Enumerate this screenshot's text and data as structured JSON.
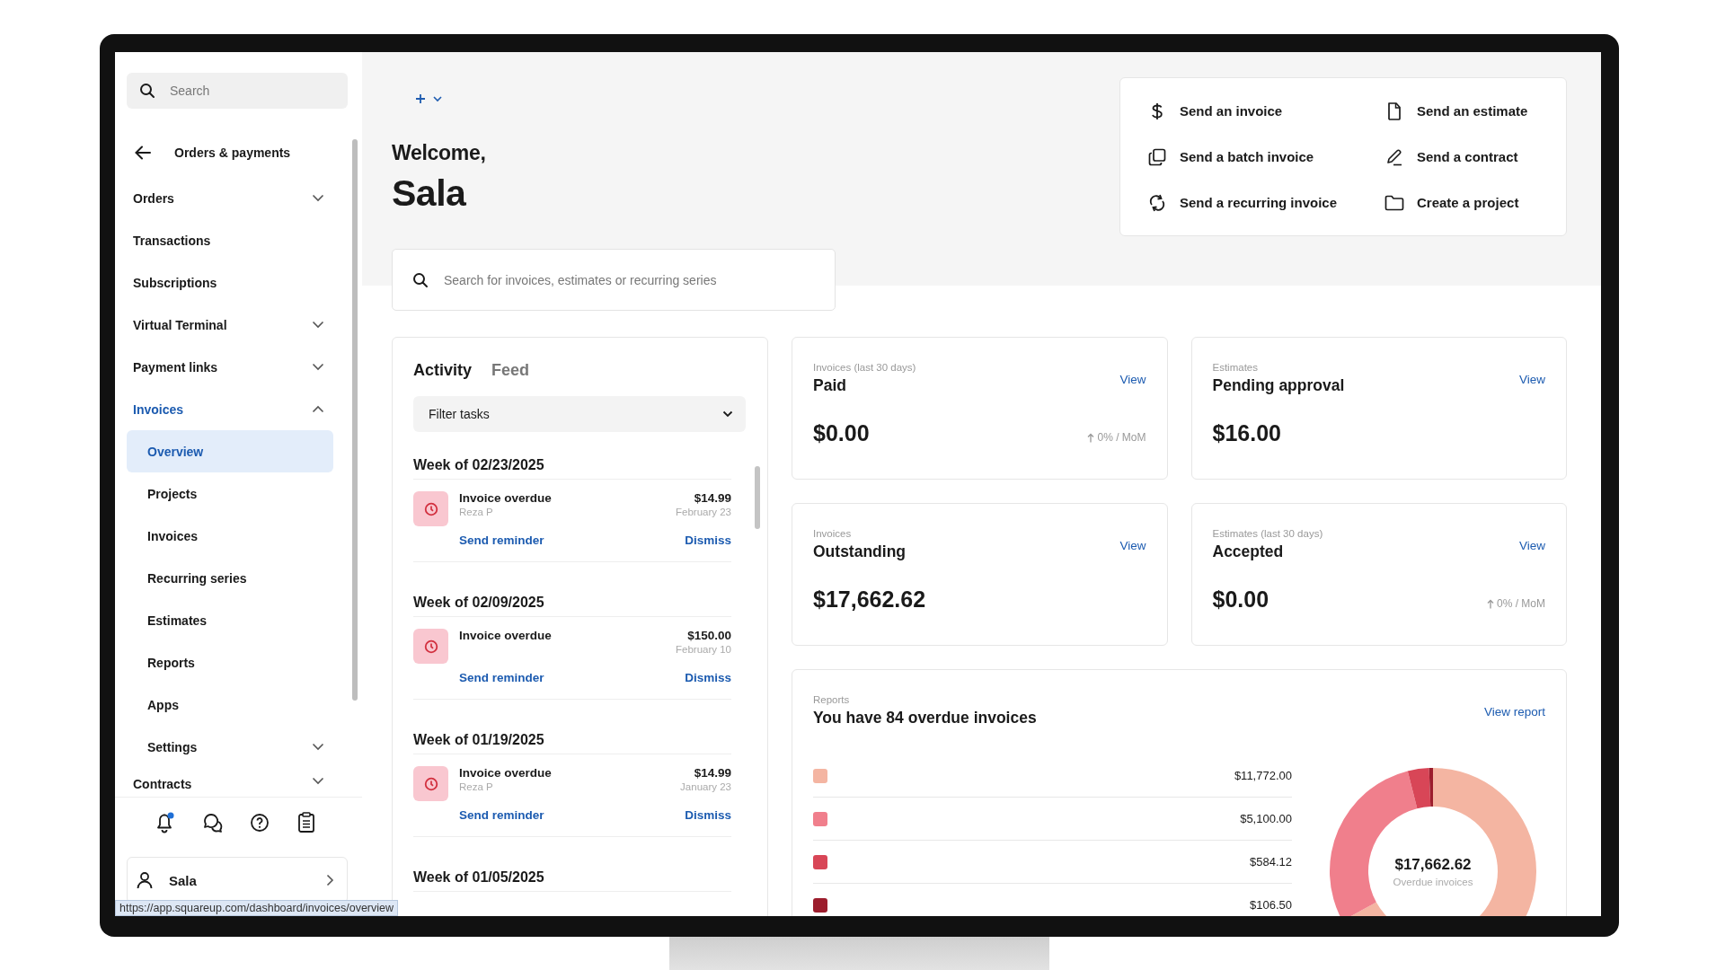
{
  "sidebar": {
    "search": {
      "placeholder": "Search"
    },
    "back_title": "Orders & payments",
    "items": [
      {
        "label": "Orders",
        "kind": "group",
        "expanded": false,
        "selected": false
      },
      {
        "label": "Transactions",
        "kind": "link",
        "selected": false
      },
      {
        "label": "Subscriptions",
        "kind": "link",
        "selected": false
      },
      {
        "label": "Virtual Terminal",
        "kind": "group",
        "expanded": false,
        "selected": false
      },
      {
        "label": "Payment links",
        "kind": "group",
        "expanded": false,
        "selected": false
      },
      {
        "label": "Invoices",
        "kind": "group",
        "expanded": true,
        "selected": false,
        "children": [
          {
            "label": "Overview",
            "kind": "link",
            "selected": true
          },
          {
            "label": "Projects",
            "kind": "link",
            "selected": false
          },
          {
            "label": "Invoices",
            "kind": "link",
            "selected": false
          },
          {
            "label": "Recurring series",
            "kind": "link",
            "selected": false
          },
          {
            "label": "Estimates",
            "kind": "link",
            "selected": false
          },
          {
            "label": "Reports",
            "kind": "link",
            "selected": false
          },
          {
            "label": "Apps",
            "kind": "link",
            "selected": false
          },
          {
            "label": "Settings",
            "kind": "group",
            "expanded": false,
            "selected": false
          }
        ]
      },
      {
        "label": "Contracts",
        "kind": "group",
        "expanded": false,
        "selected": false
      }
    ],
    "notifications_unread": true,
    "user": "Sala"
  },
  "status_url": "https://app.squareup.com/dashboard/invoices/overview",
  "header": {
    "welcome": "Welcome,",
    "name": "Sala",
    "search": {
      "placeholder": "Search for invoices, estimates or recurring series"
    }
  },
  "quick_actions": [
    {
      "label": "Send an invoice"
    },
    {
      "label": "Send an estimate"
    },
    {
      "label": "Send a batch invoice"
    },
    {
      "label": "Send a contract"
    },
    {
      "label": "Send a recurring invoice"
    },
    {
      "label": "Create a project"
    }
  ],
  "activity": {
    "tabs": [
      {
        "label": "Activity",
        "selected": true
      },
      {
        "label": "Feed",
        "selected": false
      }
    ],
    "filter": "Filter tasks",
    "weeks": [
      {
        "title": "Week of 02/23/2025",
        "items": [
          {
            "title": "Invoice overdue",
            "customer": "Reza P",
            "amount": "$14.99",
            "date": "February 23",
            "actions": [
              "Send reminder",
              "Dismiss"
            ]
          }
        ]
      },
      {
        "title": "Week of 02/09/2025",
        "items": [
          {
            "title": "Invoice overdue",
            "amount": "$150.00",
            "date": "February 10",
            "actions": [
              "Send reminder",
              "Dismiss"
            ]
          }
        ]
      },
      {
        "title": "Week of 01/19/2025",
        "items": [
          {
            "title": "Invoice overdue",
            "customer": "Reza P",
            "amount": "$14.99",
            "date": "January 23",
            "actions": [
              "Send reminder",
              "Dismiss"
            ]
          }
        ]
      },
      {
        "title": "Week of 01/05/2025"
      }
    ]
  },
  "stats": [
    {
      "caption": "Invoices (last 30 days)",
      "title": "Paid",
      "link": "View",
      "value": "$0.00",
      "change": "0% / MoM"
    },
    {
      "caption": "Estimates",
      "title": "Pending approval",
      "link": "View",
      "value": "$16.00"
    },
    {
      "caption": "Invoices",
      "title": "Outstanding",
      "link": "View",
      "value": "$17,662.62"
    },
    {
      "caption": "Estimates (last 30 days)",
      "title": "Accepted",
      "link": "View",
      "value": "$0.00",
      "change": "0% / MoM"
    }
  ],
  "report": {
    "caption": "Reports",
    "title": "You have 84 overdue invoices",
    "link": "View report",
    "legend": [
      {
        "color": "#f4b5a2",
        "amount": "$11,772.00"
      },
      {
        "color": "#f07f8c",
        "amount": "$5,100.00"
      },
      {
        "color": "#d84657",
        "amount": "$584.12"
      },
      {
        "color": "#9c1d2d",
        "amount": "$106.50"
      }
    ],
    "chart_data": {
      "type": "donut",
      "series": [
        {
          "values": [
            67.02,
            29.04,
            3.33,
            0.61
          ]
        }
      ]
    },
    "total": "$17,662.62",
    "total_label": "Overdue invoices"
  }
}
